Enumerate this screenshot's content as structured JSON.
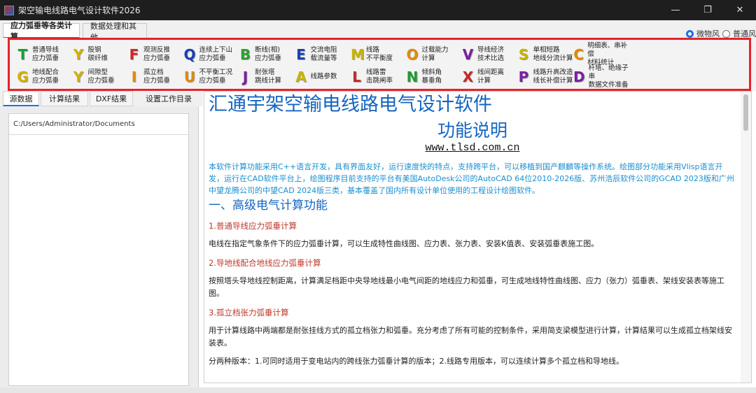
{
  "window": {
    "title": "架空输电线路电气设计软件2026",
    "controls": [
      "—",
      "❐",
      "✕"
    ]
  },
  "top_tabs": [
    {
      "label": "应力弧垂等各类计算",
      "active": true
    },
    {
      "label": "数据处理和其他",
      "active": false
    }
  ],
  "mode_radio": [
    {
      "label": "微物风",
      "checked": true
    },
    {
      "label": "普通风",
      "checked": false
    }
  ],
  "toolbar": {
    "row1": [
      {
        "letter": "T",
        "color": "#1b9e2f",
        "label": "普通导线\n应力弧垂"
      },
      {
        "letter": "Y",
        "color": "#d4b000",
        "label": "股钢\n碳纤维"
      },
      {
        "letter": "F",
        "color": "#c62828",
        "label": "观测反推\n应力弧垂"
      },
      {
        "letter": "Q",
        "color": "#1a3fb0",
        "label": "连续上下山\n应力弧垂"
      },
      {
        "letter": "B",
        "color": "#2e9e2e",
        "label": "断线(相)\n应力弧垂"
      },
      {
        "letter": "E",
        "color": "#1a3fb0",
        "label": "交流电阻\n载流量等"
      },
      {
        "letter": "M",
        "color": "#c8b400",
        "label": "线路\n不平衡度"
      },
      {
        "letter": "O",
        "color": "#e08a00",
        "label": "过载能力\n计算"
      },
      {
        "letter": "V",
        "color": "#7b1fa2",
        "label": "导线经济\n技术比选"
      },
      {
        "letter": "S",
        "color": "#c8b400",
        "label": "单相短路\n地线分流计算"
      },
      {
        "letter": "C",
        "color": "#e08a00",
        "label": "明细表、串补偿\n材料统计"
      }
    ],
    "row2": [
      {
        "letter": "G",
        "color": "#d4b000",
        "label": "地线配合\n应力弧垂"
      },
      {
        "letter": "Y",
        "color": "#d4b000",
        "label": "间隙型\n应力弧垂"
      },
      {
        "letter": "I",
        "color": "#e08a00",
        "label": "孤立档\n应力弧垂"
      },
      {
        "letter": "U",
        "color": "#e08a00",
        "label": "不平衡工况\n应力弧垂"
      },
      {
        "letter": "J",
        "color": "#7b1fa2",
        "label": "耐张塔\n跳线计算"
      },
      {
        "letter": "A",
        "color": "#c8b400",
        "label": "线路参数"
      },
      {
        "letter": "L",
        "color": "#c62828",
        "label": "线路雷\n击跳闸率"
      },
      {
        "letter": "N",
        "color": "#1b9e2f",
        "label": "倾斜角\n暴垂角"
      },
      {
        "letter": "X",
        "color": "#c62828",
        "label": "线间距离\n计算"
      },
      {
        "letter": "P",
        "color": "#7b1fa2",
        "label": "线路升高改造\n线长补偿计算"
      },
      {
        "letter": "D",
        "color": "#7b1fa2",
        "label": "杆塔、绝缘子串\n数据文件准备"
      }
    ]
  },
  "panel_tabs": [
    {
      "label": "源数据",
      "active": true
    },
    {
      "label": "计算结果",
      "active": false
    },
    {
      "label": "DXF结果",
      "active": false
    },
    {
      "label": "设置工作目录",
      "active": false
    }
  ],
  "left_panel": {
    "path": "C:/Users/Administrator/Documents"
  },
  "document": {
    "title": "汇通宇架空输电线路电气设计软件",
    "subtitle": "功能说明",
    "url": "www.tlsd.com.cn",
    "intro": "本软件计算功能采用C++语言开发，具有界面友好，运行速度快的特点，支持跨平台，可以移植到国产麒麟等操作系统。绘图部分功能采用Vlisp语言开发，运行在CAD软件平台上，绘图程序目前支持的平台有美国AutoDesk公司的AutoCAD 64位2010-2026版、苏州浩辰软件公司的GCAD 2023版和广州中望龙腾公司的中望CAD 2024版三类，基本覆盖了国内所有设计单位使用的工程设计绘图软件。",
    "section1": "一、高级电气计算功能",
    "item1_title": "1.普通导线应力弧垂计算",
    "item1_body": "电线在指定气象条件下的应力弧垂计算，可以生成特性曲线图、应力表、张力表、安装K值表、安装弧垂表施工图。",
    "item2_title": "2.导地线配合地线应力弧垂计算",
    "item2_body": "按照塔头导地线控制距离，计算满足档距中央导地线最小电气间距的地线应力和弧垂，可生成地线特性曲线图、应力（张力）弧垂表、架线安装表等施工图。",
    "item3_title": "3.孤立档张力弧垂计算",
    "item3_body": "用于计算线路中两端都是耐张挂线方式的孤立档张力和弧垂。充分考虑了所有可能的控制条件，采用简支梁模型进行计算，计算结果可以生成孤立档架线安装表。",
    "item3_note": "分两种版本：1.可同时适用于变电站内的跨线张力弧垂计算的版本；2.线路专用版本，可以连续计算多个孤立档和导地线。"
  }
}
